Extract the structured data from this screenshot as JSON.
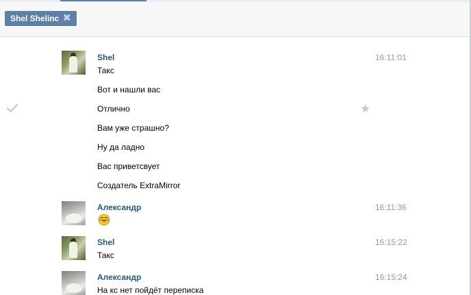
{
  "header": {
    "chip_label": "Shel Shelinc",
    "chip_close_icon": "close-icon"
  },
  "messages": [
    {
      "sender": "Shel",
      "time": "16:11:01",
      "avatar": "shel",
      "lines": [
        "Такс",
        "Вот и нашли вас",
        "Отлично",
        "Вам уже страшно?",
        "Ну да ладно",
        "Вас приветсвует",
        "Создатель ExtraMirror"
      ]
    },
    {
      "sender": "Александр",
      "time": "16:11:36",
      "avatar": "alex",
      "emoji": "laughing-tears-emoji"
    },
    {
      "sender": "Shel",
      "time": "16:15:22",
      "avatar": "shel",
      "lines": [
        "Такс"
      ]
    },
    {
      "sender": "Александр",
      "time": "16:15:24",
      "avatar": "alex",
      "lines": [
        "На кс нет пойдёт переписка"
      ]
    }
  ],
  "icons": {
    "select": "checkmark-icon",
    "favorite": "star-icon"
  },
  "colors": {
    "chip_bg": "#5f7fa3",
    "sender": "#2b587a",
    "time": "#999999",
    "accent": "#5b7fa6"
  }
}
